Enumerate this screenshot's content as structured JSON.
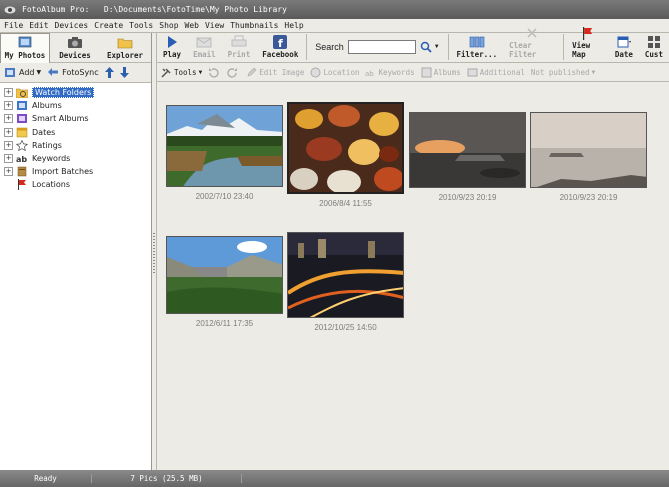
{
  "window": {
    "title": "FotoAlbum Pro:   D:\\Documents\\FotoTime\\My Photo Library"
  },
  "menu": [
    "File",
    "Edit",
    "Devices",
    "Create",
    "Tools",
    "Shop",
    "Web",
    "View",
    "Thumbnails",
    "Help"
  ],
  "view_tabs": [
    {
      "label": "My Photos",
      "icon": "photos-icon",
      "active": true
    },
    {
      "label": "Devices",
      "icon": "camera-icon",
      "active": false
    },
    {
      "label": "Explorer",
      "icon": "folder-icon",
      "active": false
    }
  ],
  "left_toolbar": {
    "add_label": "Add",
    "fotosync_label": "FotoSync"
  },
  "tree": [
    {
      "label": "Watch Folders",
      "icon": "watch-folder-icon",
      "selected": true
    },
    {
      "label": "Albums",
      "icon": "album-icon",
      "selected": false
    },
    {
      "label": "Smart Albums",
      "icon": "smart-album-icon",
      "selected": false
    },
    {
      "label": "Dates",
      "icon": "calendar-icon",
      "selected": false
    },
    {
      "label": "Ratings",
      "icon": "star-icon",
      "selected": false
    },
    {
      "label": "Keywords",
      "icon": "keyword-icon",
      "selected": false
    },
    {
      "label": "Import Batches",
      "icon": "import-icon",
      "selected": false
    },
    {
      "label": "Locations",
      "icon": "flag-icon",
      "selected": false
    }
  ],
  "main_toolbar": {
    "play": "Play",
    "email": "Email",
    "print": "Print",
    "facebook": "Facebook",
    "search_label": "Search",
    "search_value": "",
    "filter": "Filter...",
    "clear_filter": "Clear Filter",
    "view_map": "View Map",
    "date": "Date",
    "custom": "Cust"
  },
  "sec_toolbar": {
    "tools": "Tools",
    "edit_image": "Edit Image",
    "location": "Location",
    "keywords": "Keywords",
    "albums": "Albums",
    "additional": "Additional",
    "published": "Not published"
  },
  "thumbnails": [
    {
      "caption": "2002/7/10 23:40",
      "scene": "mountain-lake"
    },
    {
      "caption": "2006/8/4 11:55",
      "scene": "autumn-leaves",
      "selected": true
    },
    {
      "caption": "2010/9/23 20:19",
      "scene": "sunset-coast"
    },
    {
      "caption": "2010/9/23 20:19",
      "scene": "misty-coast"
    },
    {
      "caption": "2012/6/11 17:35",
      "scene": "valley"
    },
    {
      "caption": "2012/10/25 14:50",
      "scene": "city-night"
    }
  ],
  "status": {
    "state": "Ready",
    "count": "7 Pics (25.5 MB)"
  },
  "colors": {
    "selection": "#316ac5",
    "panel": "#ecebe6",
    "caption": "#7d7d7d"
  }
}
